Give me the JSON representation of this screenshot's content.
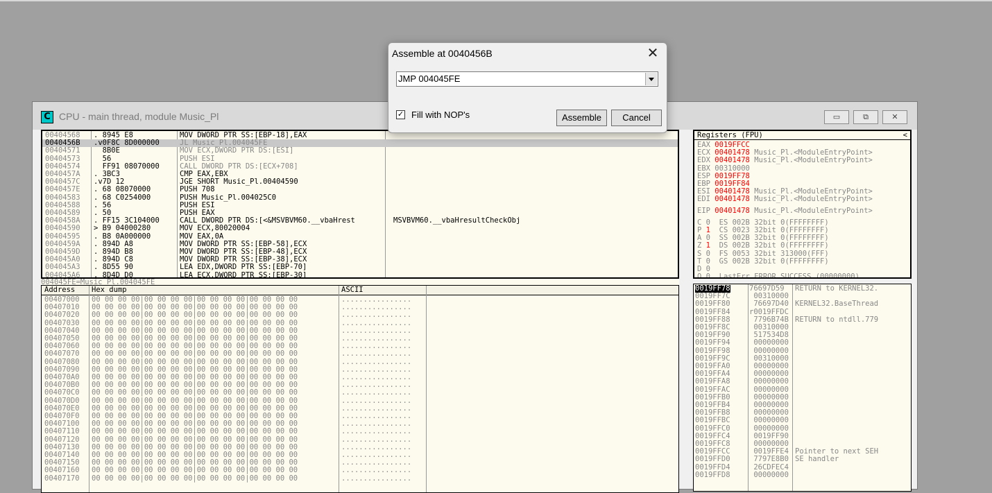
{
  "cpu_window": {
    "icon_letter": "C",
    "title": "CPU - main thread, module Music_Pl",
    "controls": {
      "minimize": "▭",
      "restore": "⧉",
      "close": "✕"
    }
  },
  "disassembly": {
    "rows": [
      {
        "addr": "00404568",
        "hex": ". 8945 E8",
        "ins": "MOV DWORD PTR SS:[EBP-18],EAX",
        "cmt": ""
      },
      {
        "addr": "0040456B",
        "hex": ".v0F8C 8D000000",
        "ins": "JL Music_Pl.004045FE",
        "cmt": "",
        "sel": true
      },
      {
        "addr": "00404571",
        "hex": "  8B0E",
        "ins": "MOV ECX,DWORD PTR DS:[ESI]",
        "cmt": "",
        "grey": true
      },
      {
        "addr": "00404573",
        "hex": "  56",
        "ins": "PUSH ESI",
        "cmt": "",
        "grey": true
      },
      {
        "addr": "00404574",
        "hex": "  FF91 08070000",
        "ins": "CALL DWORD PTR DS:[ECX+708]",
        "cmt": "",
        "grey": true
      },
      {
        "addr": "0040457A",
        "hex": ". 3BC3",
        "ins": "CMP EAX,EBX",
        "cmt": ""
      },
      {
        "addr": "0040457C",
        "hex": ".v7D 12",
        "ins": "JGE SHORT Music_Pl.00404590",
        "cmt": ""
      },
      {
        "addr": "0040457E",
        "hex": ". 68 08070000",
        "ins": "PUSH 708",
        "cmt": ""
      },
      {
        "addr": "00404583",
        "hex": ". 68 C0254000",
        "ins": "PUSH Music_Pl.004025C0",
        "cmt": ""
      },
      {
        "addr": "00404588",
        "hex": ". 56",
        "ins": "PUSH ESI",
        "cmt": ""
      },
      {
        "addr": "00404589",
        "hex": ". 50",
        "ins": "PUSH EAX",
        "cmt": ""
      },
      {
        "addr": "0040458A",
        "hex": ". FF15 3C104000",
        "ins": "CALL DWORD PTR DS:[<&MSVBVM60.__vbaHrest",
        "cmt": "MSVBVM60.__vbaHresultCheckObj"
      },
      {
        "addr": "00404590",
        "hex": "> B9 04000280",
        "ins": "MOV ECX,80020004",
        "cmt": ""
      },
      {
        "addr": "00404595",
        "hex": ". B8 0A000000",
        "ins": "MOV EAX,0A",
        "cmt": ""
      },
      {
        "addr": "0040459A",
        "hex": ". 894D A8",
        "ins": "MOV DWORD PTR SS:[EBP-58],ECX",
        "cmt": ""
      },
      {
        "addr": "0040459D",
        "hex": ". 894D B8",
        "ins": "MOV DWORD PTR SS:[EBP-48],ECX",
        "cmt": ""
      },
      {
        "addr": "004045A0",
        "hex": ". 894D C8",
        "ins": "MOV DWORD PTR SS:[EBP-38],ECX",
        "cmt": ""
      },
      {
        "addr": "004045A3",
        "hex": ". 8D55 90",
        "ins": "LEA EDX,DWORD PTR SS:[EBP-70]",
        "cmt": ""
      },
      {
        "addr": "004045A6",
        "hex": ". 8D4D D0",
        "ins": "LEA ECX,DWORD PTR SS:[EBP-30]",
        "cmt": ""
      }
    ],
    "status": "004045FE=Music_Pl.004045FE"
  },
  "registers": {
    "title": "Registers (FPU)",
    "collapse": "<",
    "lines": [
      {
        "name": "EAX",
        "val": "0019FFCC",
        "red": true,
        "cmt": ""
      },
      {
        "name": "ECX",
        "val": "00401478",
        "red": true,
        "cmt": "Music_Pl.<ModuleEntryPoint>"
      },
      {
        "name": "EDX",
        "val": "00401478",
        "red": true,
        "cmt": "Music_Pl.<ModuleEntryPoint>"
      },
      {
        "name": "EBX",
        "val": "00310000",
        "red": false,
        "cmt": ""
      },
      {
        "name": "ESP",
        "val": "0019FF78",
        "red": true,
        "cmt": ""
      },
      {
        "name": "EBP",
        "val": "0019FF84",
        "red": true,
        "cmt": ""
      },
      {
        "name": "ESI",
        "val": "00401478",
        "red": true,
        "cmt": "Music_Pl.<ModuleEntryPoint>"
      },
      {
        "name": "EDI",
        "val": "00401478",
        "red": true,
        "cmt": "Music_Pl.<ModuleEntryPoint>"
      }
    ],
    "eip": {
      "name": "EIP",
      "val": "00401478",
      "cmt": "Music_Pl.<ModuleEntryPoint>"
    },
    "flags": [
      {
        "f": "C 0",
        "seg": "ES 002B 32bit 0(FFFFFFFF)",
        "red": false
      },
      {
        "f": "P 1",
        "seg": "CS 0023 32bit 0(FFFFFFFF)",
        "red": true
      },
      {
        "f": "A 0",
        "seg": "SS 002B 32bit 0(FFFFFFFF)",
        "red": false
      },
      {
        "f": "Z 1",
        "seg": "DS 002B 32bit 0(FFFFFFFF)",
        "red": true
      },
      {
        "f": "S 0",
        "seg": "FS 0053 32bit 313000(FFF)",
        "red": false
      },
      {
        "f": "T 0",
        "seg": "GS 002B 32bit 0(FFFFFFFF)",
        "red": false
      },
      {
        "f": "D 0",
        "seg": "",
        "red": false
      },
      {
        "f": "O 0",
        "seg": "LastErr ERROR_SUCCESS (00000000)",
        "red": false
      }
    ]
  },
  "dump": {
    "headers": {
      "address": "Address",
      "hex": "Hex dump",
      "ascii": "ASCII"
    },
    "hex_bytes": "00 00 00 00|00 00 00 00|00 00 00 00|00 00 00 00",
    "ascii": "................",
    "addresses": [
      "00407000",
      "00407010",
      "00407020",
      "00407030",
      "00407040",
      "00407050",
      "00407060",
      "00407070",
      "00407080",
      "00407090",
      "004070A0",
      "004070B0",
      "004070C0",
      "004070D0",
      "004070E0",
      "004070F0",
      "00407100",
      "00407110",
      "00407120",
      "00407130",
      "00407140",
      "00407150",
      "00407160",
      "00407170"
    ]
  },
  "stack": {
    "rows": [
      {
        "addr": "0019FF78",
        "val": "76697D59",
        "cmt": "RETURN to KERNEL32.",
        "sel": true
      },
      {
        "addr": "0019FF7C",
        "val": " 00310000",
        "cmt": ""
      },
      {
        "addr": "0019FF80",
        "val": " 76697D40",
        "cmt": "KERNEL32.BaseThread"
      },
      {
        "addr": "0019FF84",
        "val": "r0019FFDC",
        "cmt": ""
      },
      {
        "addr": "0019FF88",
        "val": " 7796B74B",
        "cmt": "RETURN to ntdll.779"
      },
      {
        "addr": "0019FF8C",
        "val": " 00310000",
        "cmt": ""
      },
      {
        "addr": "0019FF90",
        "val": " 517534D8",
        "cmt": ""
      },
      {
        "addr": "0019FF94",
        "val": " 00000000",
        "cmt": ""
      },
      {
        "addr": "0019FF98",
        "val": " 00000000",
        "cmt": ""
      },
      {
        "addr": "0019FF9C",
        "val": " 00310000",
        "cmt": ""
      },
      {
        "addr": "0019FFA0",
        "val": " 00000000",
        "cmt": ""
      },
      {
        "addr": "0019FFA4",
        "val": " 00000000",
        "cmt": ""
      },
      {
        "addr": "0019FFA8",
        "val": " 00000000",
        "cmt": ""
      },
      {
        "addr": "0019FFAC",
        "val": " 00000000",
        "cmt": ""
      },
      {
        "addr": "0019FFB0",
        "val": " 00000000",
        "cmt": ""
      },
      {
        "addr": "0019FFB4",
        "val": " 00000000",
        "cmt": ""
      },
      {
        "addr": "0019FFB8",
        "val": " 00000000",
        "cmt": ""
      },
      {
        "addr": "0019FFBC",
        "val": " 00000000",
        "cmt": ""
      },
      {
        "addr": "0019FFC0",
        "val": " 00000000",
        "cmt": ""
      },
      {
        "addr": "0019FFC4",
        "val": " 0019FF90",
        "cmt": ""
      },
      {
        "addr": "0019FFC8",
        "val": " 00000000",
        "cmt": ""
      },
      {
        "addr": "0019FFCC",
        "val": " 0019FFE4",
        "cmt": "Pointer to next SEH"
      },
      {
        "addr": "0019FFD0",
        "val": " 7797E8B0",
        "cmt": "SE handler"
      },
      {
        "addr": "0019FFD4",
        "val": " 26CDFEC4",
        "cmt": ""
      },
      {
        "addr": "0019FFD8",
        "val": " 00000000",
        "cmt": ""
      }
    ]
  },
  "dialog": {
    "title": "Assemble at 0040456B",
    "close": "✕",
    "instruction": "JMP 004045FE",
    "checkbox_label": "Fill with NOP's",
    "checkbox_mark": "✓",
    "checkbox_checked": true,
    "assemble_label": "Assemble",
    "cancel_label": "Cancel"
  }
}
